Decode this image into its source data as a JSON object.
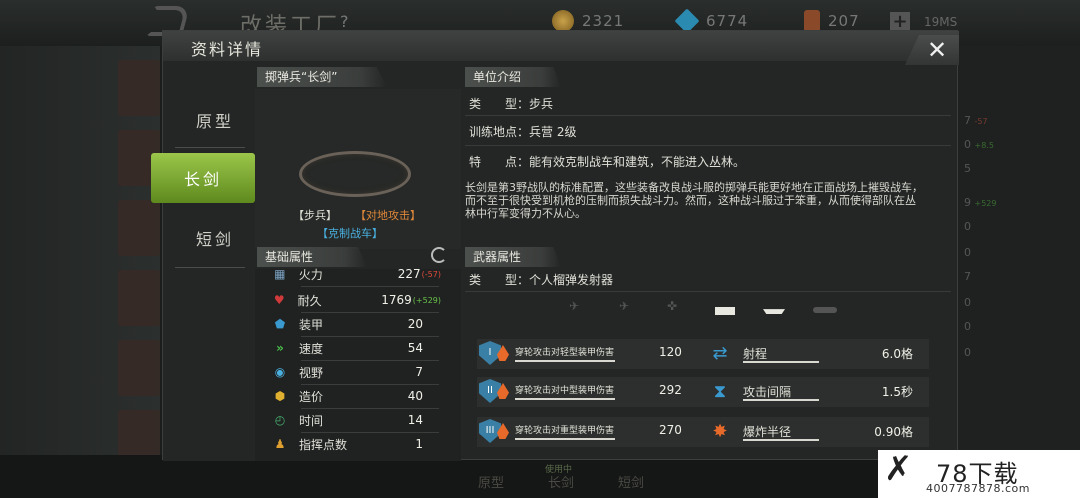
{
  "background": {
    "title": "改装工厂",
    "help": "?",
    "resources": [
      {
        "icon": "gold-coin-icon",
        "value": "2321"
      },
      {
        "icon": "diamond-icon",
        "value": "6774"
      },
      {
        "icon": "card-icon",
        "value": "207"
      }
    ],
    "network": "19MS",
    "right_nums": [
      "7",
      "0",
      "5",
      "9",
      "0",
      "0",
      "7",
      "0",
      "0",
      "0"
    ],
    "right_bonus": [
      "-57",
      "+8.5",
      "+529"
    ],
    "bottom_tabs": [
      "原型",
      "长剑",
      "短剑"
    ],
    "using_label": "使用中"
  },
  "modal": {
    "title": "资料详情",
    "close": "✕",
    "tabs": [
      "原型",
      "长剑",
      "短剑"
    ],
    "active_tab": "长剑"
  },
  "unit": {
    "name": "掷弹兵“长剑”",
    "tags": [
      "【步兵】",
      "【对地攻击】",
      "【克制战车】"
    ],
    "intro_header": "单位介绍",
    "type_row": "类　　型：步兵",
    "train_row": "训练地点：兵营 2级",
    "feature_row": "特　　点：能有效克制战车和建筑，不能进入丛林。",
    "description": "长剑是第3野战队的标准配置，这些装备改良战斗服的掷弹兵能更好地在正面战场上摧毁战车，而不至于很快受到机枪的压制而损失战斗力。然而，这种战斗服过于笨重，从而使得部队在丛林中行军变得力不从心。"
  },
  "base_stats": {
    "header": "基础属性",
    "rows": [
      {
        "label": "火力",
        "value": "227",
        "bonus": "(-57)",
        "icon": "firepower-icon"
      },
      {
        "label": "耐久",
        "value": "1769",
        "bonus": "(+529)",
        "icon": "heart-icon"
      },
      {
        "label": "装甲",
        "value": "20",
        "bonus": "",
        "icon": "armor-icon"
      },
      {
        "label": "速度",
        "value": "54",
        "bonus": "",
        "icon": "speed-icon"
      },
      {
        "label": "视野",
        "value": "7",
        "bonus": "",
        "icon": "eye-icon"
      },
      {
        "label": "造价",
        "value": "40",
        "bonus": "",
        "icon": "cost-icon"
      },
      {
        "label": "时间",
        "value": "14",
        "bonus": "",
        "icon": "clock-icon"
      },
      {
        "label": "指挥点数",
        "value": "1",
        "bonus": "",
        "icon": "command-icon"
      }
    ]
  },
  "weapon": {
    "header": "武器属性",
    "type_row": "类　　型：个人榴弹发射器",
    "targets": [
      "aircraft-icon",
      "jet-icon",
      "helicopter-icon",
      "tank-icon",
      "ship-icon",
      "submarine-icon"
    ],
    "damage_rows": [
      {
        "icon_text": "I",
        "label": "穿轮攻击对轻型装甲伤害",
        "value": "120"
      },
      {
        "icon_text": "II",
        "label": "穿轮攻击对中型装甲伤害",
        "value": "292"
      },
      {
        "icon_text": "III",
        "label": "穿轮攻击对重型装甲伤害",
        "value": "270"
      }
    ],
    "attr_rows": [
      {
        "label": "射程",
        "value": "6.0格",
        "icon": "range-icon"
      },
      {
        "label": "攻击间隔",
        "value": "1.5秒",
        "icon": "hourglass-icon"
      },
      {
        "label": "爆炸半径",
        "value": "0.90格",
        "icon": "explosion-icon"
      }
    ]
  },
  "watermark": {
    "name": "78下载",
    "tel": "4007787878.com"
  },
  "colors": {
    "accent_green": "#8ab53c",
    "bonus_red": "#e04a3a",
    "bonus_green": "#6ac24a",
    "tag_red": "#e0883a",
    "tag_blue": "#4ab0e0"
  }
}
